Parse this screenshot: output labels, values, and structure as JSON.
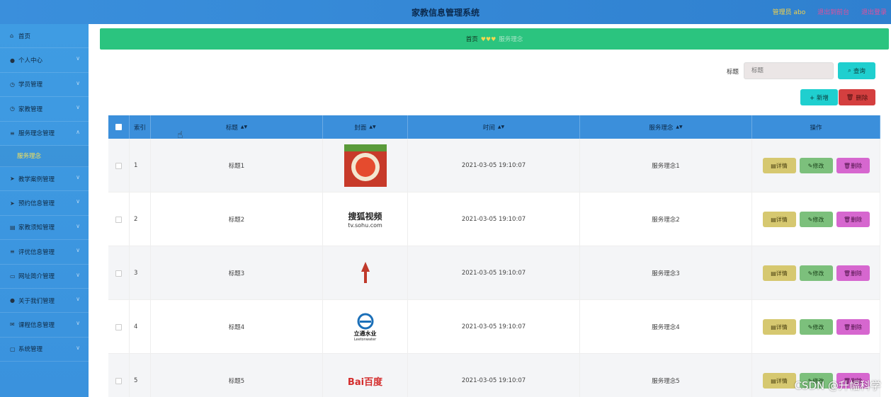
{
  "header": {
    "title": "家教信息管理系统",
    "admin": "管理员 abo",
    "back_link": "退出到前台",
    "logout_link": "退出登录"
  },
  "sidebar": {
    "items": [
      {
        "label": "首页",
        "icon": "home-icon"
      },
      {
        "label": "个人中心",
        "icon": "user-icon"
      },
      {
        "label": "学员管理",
        "icon": "clock-icon"
      },
      {
        "label": "家教管理",
        "icon": "clock-icon"
      },
      {
        "label": "服务理念管理",
        "icon": "list-icon"
      },
      {
        "label": "教学案例管理",
        "icon": "send-icon"
      },
      {
        "label": "预约信息管理",
        "icon": "send-icon"
      },
      {
        "label": "家教须知管理",
        "icon": "folder-icon"
      },
      {
        "label": "评优信息管理",
        "icon": "list-icon"
      },
      {
        "label": "网址简介管理",
        "icon": "monitor-icon"
      },
      {
        "label": "关于我们管理",
        "icon": "user-icon"
      },
      {
        "label": "课程信息管理",
        "icon": "mail-icon"
      },
      {
        "label": "系统管理",
        "icon": "chat-icon"
      }
    ],
    "sub_item": "服务理念"
  },
  "breadcrumb": {
    "home": "首页",
    "current": "服务理念"
  },
  "search": {
    "label": "标题",
    "placeholder": "标题",
    "button": "查询"
  },
  "actions": {
    "add": "+ 新增",
    "delete": "删除"
  },
  "table": {
    "headers": [
      "索引",
      "标题",
      "封面",
      "时间",
      "服务理念",
      "操作"
    ],
    "rows": [
      {
        "index": "1",
        "title": "标题1",
        "time": "2021-03-05 19:10:07",
        "concept": "服务理念1"
      },
      {
        "index": "2",
        "title": "标题2",
        "time": "2021-03-05 19:10:07",
        "concept": "服务理念2"
      },
      {
        "index": "3",
        "title": "标题3",
        "time": "2021-03-05 19:10:07",
        "concept": "服务理念3"
      },
      {
        "index": "4",
        "title": "标题4",
        "time": "2021-03-05 19:10:07",
        "concept": "服务理念4"
      },
      {
        "index": "5",
        "title": "标题5",
        "time": "2021-03-05 19:10:07",
        "concept": "服务理念5"
      }
    ],
    "ops": {
      "detail": "详情",
      "edit": "修改",
      "delete": "删除"
    }
  },
  "logos": {
    "sohu": "搜狐视频",
    "sohu_url": "tv.sohu.com",
    "lingtong": "立通水业",
    "lingtong_en": "Leetonwater",
    "baidu": "Bai百度"
  },
  "watermark": "CSDN @升幅科学"
}
